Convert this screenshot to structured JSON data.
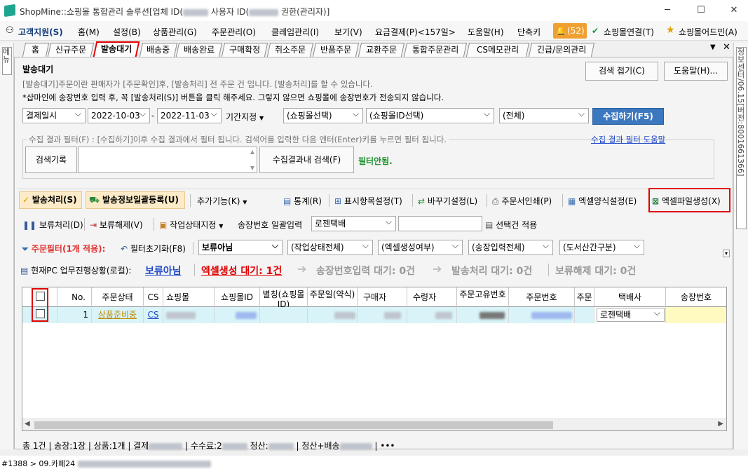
{
  "window": {
    "title_pre": "ShopMine::쇼핑몰 통합관리 솔루션[업체 ID(",
    "title_mid": " 사용자 ID(",
    "title_post": " 권한(관리자)]"
  },
  "menu": {
    "support": "고객지원(S)",
    "items": [
      "홈(M)",
      "설정(B)",
      "상품관리(G)",
      "주문관리(O)",
      "클레임관리(I)",
      "보기(V)",
      "요금결제(P)<157일>",
      "도움말(H)",
      "단축키"
    ],
    "notify_count": "(52)",
    "connect": "쇼핑몰연결(T)",
    "addon": "쇼핑몰어드민(A)"
  },
  "tabs": [
    "홈",
    "신규주문",
    "발송대기",
    "배송중",
    "배송완료",
    "구매확정",
    "취소주문",
    "반품주문",
    "교환주문",
    "통합주문관리",
    "CS메모관리",
    "긴급/문의관리"
  ],
  "side": {
    "left": "메뉴",
    "right": "정보센터/06.15[버전:8001661366]"
  },
  "header": {
    "title": "발송대기",
    "collapse_btn": "검색 접기(C)",
    "help_btn": "도움말(H)...",
    "desc1": "[발송대기]주문이란 판매자가 [주문확인]후, [발송처리] 전 주문 건 입니다. [발송처리]를 할 수 있습니다.",
    "desc2": "*샵마인에 송장번호 입력 후, 꼭 [발송처리(S)] 버튼을 클릭 해주세요. 그렇지 않으면 쇼핑몰에 송장번호가 전송되지 않습니다."
  },
  "search": {
    "date_type": "결제일시",
    "date_from": "2022-10-03",
    "dash": "-",
    "date_to": "2022-11-03",
    "period": "기간지정",
    "mall": "(쇼핑몰선택)",
    "mall_id": "(쇼핑몰ID선택)",
    "all": "(전체)",
    "collect_btn": "수집하기(F5)"
  },
  "filter": {
    "legend": "수집 결과 필터(F) : [수집하기]이후 수집 결과에서 필터 됩니다. 검색어를 입력한 다음 엔터(Enter)키를 누르면 필터 됩니다.",
    "help_link": "수집 결과 필터 도움말",
    "history_btn": "검색기록",
    "search_btn": "수집결과내 검색(F)",
    "status": "필터안됨."
  },
  "toolbar1": {
    "ship": "발송처리(S)",
    "bulk": "발송정보일괄등록(U)",
    "more": "추가기능(K)",
    "stats": "통계(R)",
    "columns": "표시항목설정(T)",
    "replace": "바꾸기설정(L)",
    "print": "주문서인쇄(P)",
    "excel_form": "엑셀양식설정(E)",
    "excel_make": "엑셀파일생성(X)"
  },
  "toolbar2": {
    "hold": "보류처리(D)",
    "unhold": "보류해제(V)",
    "work_state": "작업상태지정",
    "invoice_bulk": "송장번호 일괄입력",
    "courier": "로젠택배",
    "apply_selected": "선택건 적용"
  },
  "toolbar3": {
    "order_filter": "주문필터(1개 적용):",
    "reset": "필터초기화(F8)",
    "hold_filter": "보류아님",
    "work_all": "(작업상태전체)",
    "excel_state": "(엑셀생성여부)",
    "invoice_state": "(송장입력전체)",
    "remote": "(도서산간구분)"
  },
  "progress": {
    "label": "현재PC 업무진행상황(로컬):",
    "step1": "보류아님",
    "step2": "엑셀생성 대기: 1건",
    "step3": "송장번호입력 대기: 0건",
    "step4": "발송처리 대기: 0건",
    "step5": "보류해제 대기: 0건"
  },
  "grid": {
    "columns": [
      "No.",
      "주문상태",
      "CS",
      "쇼핑몰",
      "쇼핑몰ID",
      "별칭(쇼핑몰ID)",
      "주문일(약식)",
      "구매자",
      "수령자",
      "주문고유번호",
      "주문번호",
      "주문",
      "택배사",
      "송장번호"
    ],
    "rows": [
      {
        "no": "1",
        "state": "상품준비중",
        "cs": "CS",
        "courier": "로젠택배"
      }
    ]
  },
  "statusbar": {
    "total": "총 1건",
    "invoice": "송장:1장",
    "product": "상품:1개",
    "pay": "결제",
    "fee": "수수료:2",
    "settle": "정산:",
    "settle_ship": "정산+배송",
    "more": "•••"
  },
  "bottom": {
    "path": "#1388 > 09.카페24"
  }
}
